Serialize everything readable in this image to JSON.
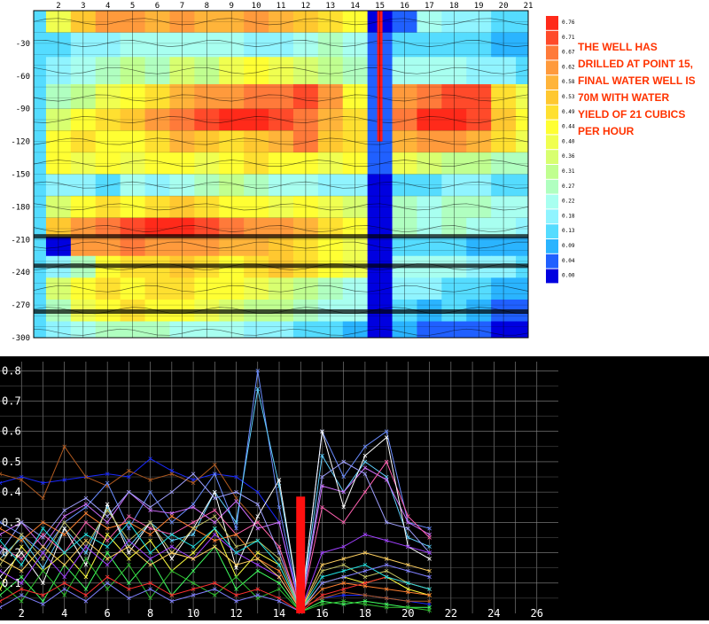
{
  "annotation": {
    "lines": [
      "THE  WELL  HAS",
      "DRILLED AT POINT 15,",
      "FINAL WATER WELL IS",
      "70M WITH WATER",
      "YIELD OF 21 CUBICS",
      "PER HOUR"
    ]
  },
  "chart_data": [
    {
      "type": "heatmap",
      "x_ticks": [
        "2",
        "3",
        "4",
        "5",
        "6",
        "7",
        "8",
        "9",
        "10",
        "11",
        "12",
        "13",
        "14",
        "15",
        "16",
        "17",
        "18",
        "19",
        "20",
        "21"
      ],
      "x_range": [
        1,
        21
      ],
      "y_ticks": [
        "-30",
        "-60",
        "-90",
        "-120",
        "-150",
        "-180",
        "-210",
        "-240",
        "-270",
        "-300"
      ],
      "y_range": [
        0,
        -300
      ],
      "highlight_x": 15,
      "highlight_depth_range": [
        0,
        -120
      ],
      "colorbar": {
        "labels": [
          "0.76",
          "0.71",
          "0.67",
          "0.62",
          "0.58",
          "0.53",
          "0.49",
          "0.44",
          "0.40",
          "0.36",
          "0.31",
          "0.27",
          "0.22",
          "0.18",
          "0.13",
          "0.09",
          "0.04",
          "0.00"
        ],
        "colors": [
          "#ff2a1a",
          "#ff4a2a",
          "#ff7a3a",
          "#ff9a3c",
          "#ffb43a",
          "#ffc830",
          "#ffe030",
          "#ffff33",
          "#f0ff50",
          "#d8ff70",
          "#c0ff90",
          "#b0ffc0",
          "#a8fff0",
          "#90f4ff",
          "#55dcff",
          "#2ab4ff",
          "#2060ff",
          "#0000e0"
        ]
      },
      "rows": [
        {
          "y": -10,
          "values": [
            0.42,
            0.55,
            0.62,
            0.66,
            0.6,
            0.62,
            0.58,
            0.6,
            0.62,
            0.6,
            0.55,
            0.5,
            0.46,
            0.0,
            0.05,
            0.22,
            0.2,
            0.18,
            0.16,
            0.14
          ]
        },
        {
          "y": -30,
          "values": [
            0.14,
            0.18,
            0.2,
            0.24,
            0.22,
            0.26,
            0.22,
            0.24,
            0.2,
            0.18,
            0.24,
            0.28,
            0.26,
            0.05,
            0.16,
            0.14,
            0.16,
            0.14,
            0.12,
            0.12
          ]
        },
        {
          "y": -55,
          "values": [
            0.2,
            0.24,
            0.28,
            0.32,
            0.3,
            0.36,
            0.34,
            0.4,
            0.44,
            0.4,
            0.36,
            0.32,
            0.3,
            0.05,
            0.22,
            0.24,
            0.22,
            0.2,
            0.18,
            0.16
          ]
        },
        {
          "y": -80,
          "values": [
            0.3,
            0.34,
            0.4,
            0.46,
            0.52,
            0.58,
            0.62,
            0.66,
            0.7,
            0.68,
            0.74,
            0.62,
            0.48,
            0.05,
            0.62,
            0.7,
            0.74,
            0.72,
            0.5,
            0.4
          ]
        },
        {
          "y": -100,
          "values": [
            0.38,
            0.44,
            0.5,
            0.56,
            0.62,
            0.68,
            0.72,
            0.76,
            0.78,
            0.74,
            0.7,
            0.58,
            0.52,
            0.05,
            0.7,
            0.76,
            0.78,
            0.72,
            0.56,
            0.44
          ]
        },
        {
          "y": -120,
          "values": [
            0.46,
            0.52,
            0.48,
            0.44,
            0.52,
            0.58,
            0.54,
            0.5,
            0.56,
            0.58,
            0.68,
            0.56,
            0.5,
            0.05,
            0.58,
            0.64,
            0.66,
            0.58,
            0.5,
            0.42
          ]
        },
        {
          "y": -140,
          "values": [
            0.48,
            0.42,
            0.46,
            0.4,
            0.44,
            0.48,
            0.42,
            0.46,
            0.5,
            0.44,
            0.48,
            0.42,
            0.46,
            0.04,
            0.4,
            0.36,
            0.34,
            0.32,
            0.3,
            0.28
          ]
        },
        {
          "y": -160,
          "values": [
            0.18,
            0.2,
            0.16,
            0.22,
            0.2,
            0.24,
            0.28,
            0.34,
            0.3,
            0.26,
            0.24,
            0.2,
            0.18,
            0.03,
            0.16,
            0.14,
            0.18,
            0.2,
            0.16,
            0.14
          ]
        },
        {
          "y": -180,
          "values": [
            0.36,
            0.48,
            0.5,
            0.46,
            0.52,
            0.56,
            0.5,
            0.48,
            0.44,
            0.4,
            0.44,
            0.4,
            0.36,
            0.03,
            0.3,
            0.26,
            0.3,
            0.28,
            0.24,
            0.22
          ]
        },
        {
          "y": -200,
          "values": [
            0.54,
            0.62,
            0.7,
            0.74,
            0.76,
            0.76,
            0.72,
            0.7,
            0.66,
            0.62,
            0.58,
            0.52,
            0.46,
            0.03,
            0.3,
            0.26,
            0.28,
            0.24,
            0.22,
            0.2
          ]
        },
        {
          "y": -215,
          "values": [
            0.02,
            0.62,
            0.66,
            0.68,
            0.66,
            0.64,
            0.62,
            0.6,
            0.58,
            0.54,
            0.5,
            0.46,
            0.4,
            0.03,
            0.14,
            0.16,
            0.14,
            0.12,
            0.12,
            0.1
          ]
        },
        {
          "y": -235,
          "values": [
            0.2,
            0.3,
            0.44,
            0.5,
            0.52,
            0.54,
            0.5,
            0.46,
            0.5,
            0.54,
            0.5,
            0.46,
            0.42,
            0.03,
            0.26,
            0.22,
            0.24,
            0.2,
            0.18,
            0.16
          ]
        },
        {
          "y": -255,
          "values": [
            0.36,
            0.46,
            0.5,
            0.48,
            0.52,
            0.5,
            0.46,
            0.44,
            0.4,
            0.36,
            0.34,
            0.3,
            0.26,
            0.03,
            0.18,
            0.2,
            0.16,
            0.14,
            0.12,
            0.1
          ]
        },
        {
          "y": -275,
          "values": [
            0.3,
            0.4,
            0.46,
            0.5,
            0.48,
            0.46,
            0.4,
            0.38,
            0.34,
            0.32,
            0.28,
            0.26,
            0.22,
            0.03,
            0.14,
            0.12,
            0.14,
            0.12,
            0.08,
            0.06
          ]
        },
        {
          "y": -295,
          "values": [
            0.2,
            0.24,
            0.28,
            0.3,
            0.28,
            0.26,
            0.24,
            0.22,
            0.2,
            0.18,
            0.16,
            0.14,
            0.12,
            0.02,
            0.1,
            0.08,
            0.06,
            0.04,
            0.03,
            0.02
          ]
        }
      ]
    },
    {
      "type": "line",
      "x_ticks": [
        "2",
        "4",
        "6",
        "8",
        "10",
        "12",
        "14",
        "16",
        "18",
        "20",
        "22",
        "24",
        "26"
      ],
      "x_range": [
        1,
        27
      ],
      "y_ticks": [
        "0.1",
        "0.2",
        "0.3",
        "0.4",
        "0.5",
        "0.6",
        "0.7",
        "0.8"
      ],
      "y_range": [
        0,
        0.83
      ],
      "grid": true,
      "x": [
        1,
        2,
        3,
        4,
        5,
        6,
        7,
        8,
        9,
        10,
        11,
        12,
        13,
        14,
        15,
        16,
        17,
        18,
        19,
        20,
        21
      ],
      "highlight": {
        "x": 15,
        "value": 0.385,
        "color": "#ff1010"
      },
      "series": [
        {
          "color": "#1a2aff",
          "values": [
            0.43,
            0.45,
            0.43,
            0.44,
            0.45,
            0.46,
            0.45,
            0.51,
            0.47,
            0.44,
            0.46,
            0.45,
            0.4,
            0.3,
            0.02,
            0.05,
            0.06,
            0.06,
            0.05,
            0.04,
            0.03
          ]
        },
        {
          "color": "#b05a20",
          "values": [
            0.46,
            0.44,
            0.38,
            0.55,
            0.45,
            0.42,
            0.47,
            0.44,
            0.46,
            0.43,
            0.49,
            0.38,
            0.3,
            0.22,
            0.02,
            0.05,
            0.07,
            0.06,
            0.05,
            0.04,
            0.04
          ]
        },
        {
          "color": "#6a8cff",
          "values": [
            0.3,
            0.26,
            0.2,
            0.3,
            0.35,
            0.43,
            0.28,
            0.4,
            0.3,
            0.36,
            0.46,
            0.28,
            0.8,
            0.35,
            0.01,
            0.6,
            0.45,
            0.55,
            0.6,
            0.3,
            0.28
          ]
        },
        {
          "color": "#60d0ff",
          "values": [
            0.18,
            0.25,
            0.15,
            0.28,
            0.2,
            0.35,
            0.22,
            0.3,
            0.24,
            0.26,
            0.4,
            0.3,
            0.74,
            0.42,
            0.01,
            0.52,
            0.4,
            0.5,
            0.45,
            0.25,
            0.22
          ]
        },
        {
          "color": "#d070ff",
          "values": [
            0.26,
            0.3,
            0.22,
            0.32,
            0.36,
            0.3,
            0.4,
            0.34,
            0.33,
            0.35,
            0.3,
            0.37,
            0.28,
            0.3,
            0.01,
            0.42,
            0.4,
            0.48,
            0.44,
            0.3,
            0.26
          ]
        },
        {
          "color": "#ff60b0",
          "values": [
            0.22,
            0.18,
            0.26,
            0.2,
            0.3,
            0.24,
            0.32,
            0.28,
            0.26,
            0.3,
            0.34,
            0.26,
            0.3,
            0.22,
            0.01,
            0.35,
            0.3,
            0.4,
            0.5,
            0.32,
            0.25
          ]
        },
        {
          "color": "#ffffff",
          "values": [
            0.12,
            0.2,
            0.1,
            0.28,
            0.16,
            0.36,
            0.2,
            0.3,
            0.18,
            0.28,
            0.4,
            0.15,
            0.32,
            0.44,
            0.01,
            0.6,
            0.35,
            0.52,
            0.58,
            0.22,
            0.18
          ]
        },
        {
          "color": "#a0a0ff",
          "values": [
            0.2,
            0.3,
            0.25,
            0.34,
            0.38,
            0.32,
            0.4,
            0.35,
            0.4,
            0.46,
            0.38,
            0.4,
            0.36,
            0.2,
            0.01,
            0.45,
            0.5,
            0.46,
            0.3,
            0.28,
            0.2
          ]
        },
        {
          "color": "#ffff40",
          "values": [
            0.08,
            0.22,
            0.14,
            0.2,
            0.12,
            0.26,
            0.18,
            0.24,
            0.14,
            0.2,
            0.28,
            0.12,
            0.2,
            0.16,
            0.01,
            0.1,
            0.12,
            0.1,
            0.12,
            0.08,
            0.06
          ]
        },
        {
          "color": "#ff8030",
          "values": [
            0.28,
            0.24,
            0.3,
            0.26,
            0.33,
            0.28,
            0.3,
            0.26,
            0.32,
            0.28,
            0.24,
            0.26,
            0.18,
            0.14,
            0.01,
            0.08,
            0.1,
            0.09,
            0.08,
            0.07,
            0.06
          ]
        },
        {
          "color": "#40ff60",
          "values": [
            0.06,
            0.12,
            0.04,
            0.16,
            0.08,
            0.2,
            0.1,
            0.18,
            0.06,
            0.14,
            0.22,
            0.08,
            0.14,
            0.1,
            0.005,
            0.04,
            0.03,
            0.04,
            0.03,
            0.02,
            0.02
          ]
        },
        {
          "color": "#30c030",
          "values": [
            0.1,
            0.04,
            0.14,
            0.06,
            0.18,
            0.08,
            0.16,
            0.05,
            0.14,
            0.1,
            0.06,
            0.12,
            0.05,
            0.08,
            0.005,
            0.03,
            0.04,
            0.03,
            0.02,
            0.02,
            0.01
          ]
        },
        {
          "color": "#c0c060",
          "values": [
            0.16,
            0.26,
            0.18,
            0.3,
            0.22,
            0.34,
            0.24,
            0.3,
            0.2,
            0.28,
            0.32,
            0.22,
            0.24,
            0.18,
            0.01,
            0.14,
            0.16,
            0.12,
            0.14,
            0.1,
            0.08
          ]
        },
        {
          "color": "#ff3030",
          "values": [
            0.04,
            0.08,
            0.06,
            0.1,
            0.06,
            0.12,
            0.08,
            0.1,
            0.06,
            0.08,
            0.1,
            0.06,
            0.08,
            0.05,
            0.005,
            0.06,
            0.08,
            0.1,
            0.12,
            0.1,
            0.08
          ]
        },
        {
          "color": "#a040ff",
          "values": [
            0.14,
            0.1,
            0.2,
            0.12,
            0.22,
            0.16,
            0.24,
            0.18,
            0.22,
            0.18,
            0.26,
            0.2,
            0.16,
            0.12,
            0.01,
            0.2,
            0.22,
            0.26,
            0.24,
            0.22,
            0.2
          ]
        },
        {
          "color": "#20e0e0",
          "values": [
            0.24,
            0.16,
            0.28,
            0.2,
            0.26,
            0.22,
            0.3,
            0.2,
            0.26,
            0.22,
            0.28,
            0.2,
            0.24,
            0.16,
            0.01,
            0.12,
            0.14,
            0.16,
            0.12,
            0.1,
            0.08
          ]
        },
        {
          "color": "#ffd060",
          "values": [
            0.18,
            0.14,
            0.22,
            0.16,
            0.24,
            0.18,
            0.22,
            0.16,
            0.2,
            0.18,
            0.22,
            0.16,
            0.18,
            0.12,
            0.01,
            0.16,
            0.18,
            0.2,
            0.18,
            0.16,
            0.14
          ]
        },
        {
          "color": "#8080ff",
          "values": [
            0.02,
            0.06,
            0.03,
            0.08,
            0.04,
            0.1,
            0.05,
            0.08,
            0.04,
            0.06,
            0.08,
            0.04,
            0.06,
            0.04,
            0.005,
            0.1,
            0.12,
            0.14,
            0.16,
            0.14,
            0.12
          ]
        }
      ]
    }
  ]
}
